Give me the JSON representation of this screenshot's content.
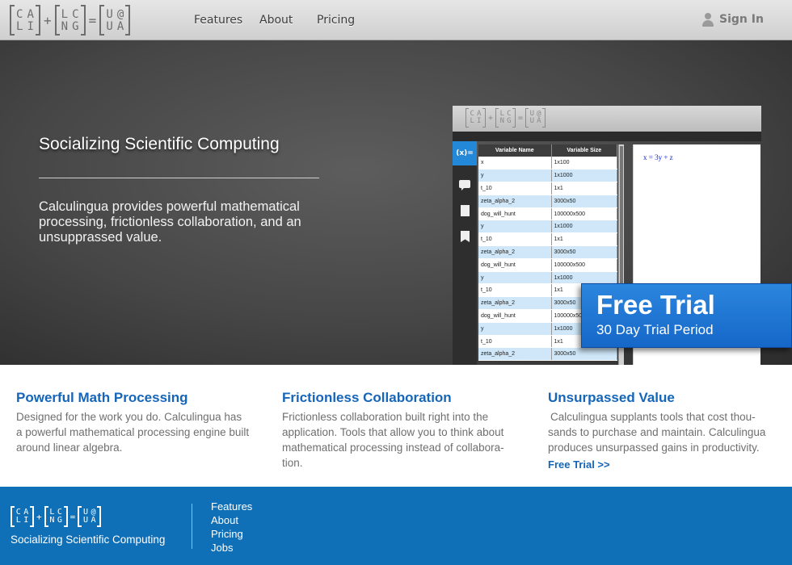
{
  "logo": {
    "rows": [
      [
        "C",
        "A",
        "L",
        "I"
      ],
      [
        "L",
        "C",
        "N",
        "G"
      ],
      [
        "U",
        "@",
        "U",
        "A"
      ]
    ],
    "plus": "+",
    "equals": "="
  },
  "header": {
    "nav": [
      "Features",
      "About",
      "Pricing"
    ],
    "sign_in": "Sign In",
    "user_icon": "user-icon"
  },
  "hero": {
    "title": "Socializing Scientific Computing",
    "description": "Calculingua provides powerful mathematical processing, frictionless collaboration, and an unsupprassed value."
  },
  "app_preview": {
    "sidebar": {
      "fx_label": "(x)=",
      "icons": [
        "chat-icon",
        "document-icon",
        "bookmark-icon"
      ]
    },
    "table": {
      "headers": [
        "Variable Name",
        "Variable Size"
      ],
      "rows": [
        [
          "x",
          "1x100"
        ],
        [
          "y",
          "1x1000"
        ],
        [
          "t_10",
          "1x1"
        ],
        [
          "zeta_alpha_2",
          "3000x50"
        ],
        [
          "dog_will_hunt",
          "100000x500"
        ],
        [
          "y",
          "1x1000"
        ],
        [
          "t_10",
          "1x1"
        ],
        [
          "zeta_alpha_2",
          "3000x50"
        ],
        [
          "dog_will_hunt",
          "100000x500"
        ],
        [
          "y",
          "1x1000"
        ],
        [
          "t_10",
          "1x1"
        ],
        [
          "zeta_alpha_2",
          "3000x50"
        ],
        [
          "dog_will_hunt",
          "100000x500"
        ],
        [
          "y",
          "1x1000"
        ],
        [
          "t_10",
          "1x1"
        ],
        [
          "zeta_alpha_2",
          "3000x50"
        ]
      ]
    },
    "editor_text": "x = 3y + z"
  },
  "trial_banner": {
    "title": "Free Trial",
    "subtitle": "30 Day Trial Period"
  },
  "features": [
    {
      "title": "Powerful Math Processing",
      "text": "Designed for the work you do. Calculingua has a powerful mathematical processing engine built around linear algebra."
    },
    {
      "title": "Frictionless Collaboration",
      "text": "Frictionless collaboration built right into the application. Tools that allow you to think about mathematical processing instead of collabora-tion."
    },
    {
      "title": "Unsurpassed Value",
      "text": "Calculingua supplants tools that cost thou-sands to purchase and maintain. Calculingua produces unsurpassed gains in productivity.",
      "link": "Free Trial >>"
    }
  ],
  "footer": {
    "tagline": "Socializing Scientific Computing",
    "nav": [
      "Features",
      "About",
      "Pricing",
      "Jobs"
    ]
  },
  "colors": {
    "brand_blue": "#1565b8",
    "footer_blue": "#0f6fb7",
    "trial_blue": "#1f78d6",
    "table_highlight": "#cfe7f8"
  }
}
